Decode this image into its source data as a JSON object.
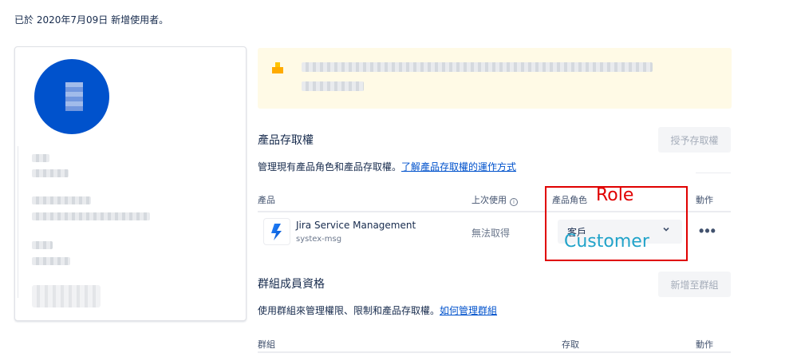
{
  "header": {
    "added_note": "已於 2020年7月09日 新增使用者。"
  },
  "product_access": {
    "title": "產品存取權",
    "grant_button": "授予存取權",
    "description": "管理現有產品角色和產品存取權。",
    "learn_link": "了解產品存取權的運作方式",
    "columns": {
      "product": "產品",
      "last_used": "上次使用",
      "role": "產品角色",
      "actions": "動作"
    },
    "rows": [
      {
        "product": "Jira Service Management",
        "site": "systex-msg",
        "last_used": "無法取得",
        "role": "客戶"
      }
    ]
  },
  "group_membership": {
    "title": "群組成員資格",
    "add_button": "新增至群組",
    "description": "使用群組來管理權限、限制和產品存取權。",
    "how_link": "如何管理群組",
    "columns": {
      "group": "群組",
      "access": "存取",
      "actions": "動作"
    }
  },
  "annotations": {
    "role": "Role",
    "customer": "Customer"
  },
  "colors": {
    "avatar": "#0052cc",
    "banner": "#fffae6",
    "annotation_box": "#e00000",
    "annotation_customer": "#21a3c9",
    "link": "#0052cc"
  },
  "icons": {
    "product": "jira-service-management-icon",
    "info": "info-icon",
    "chevron": "chevron-down-icon",
    "more": "more-icon"
  }
}
